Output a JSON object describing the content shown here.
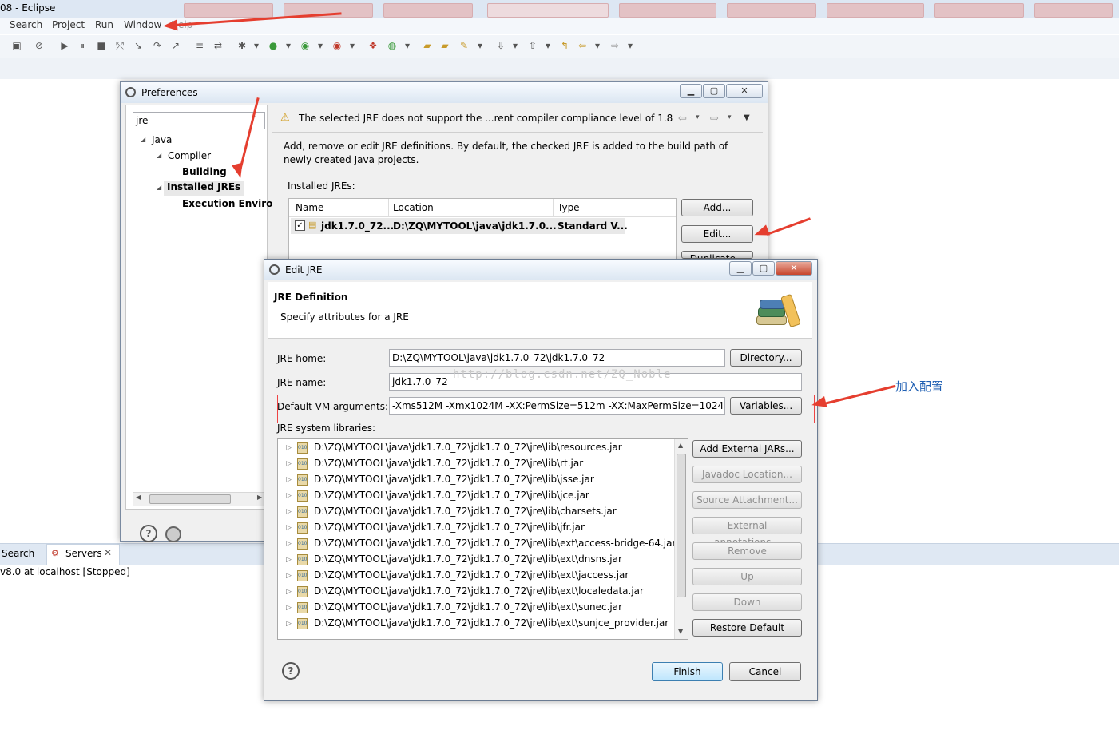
{
  "eclipse": {
    "title": "08 - Eclipse",
    "menu": [
      "Search",
      "Project",
      "Run",
      "Window",
      "Help"
    ]
  },
  "servers": {
    "tabs": [
      "Search",
      "Servers"
    ],
    "entry": "v8.0 at localhost  [Stopped]"
  },
  "preferences": {
    "title": "Preferences",
    "filter_value": "jre",
    "tree": {
      "java": "Java",
      "compiler": "Compiler",
      "building": "Building",
      "installed_jres": "Installed JREs",
      "execution_env": "Execution Enviro"
    },
    "warning": "The selected JRE does not support the ...rent compiler compliance level of 1.8",
    "description": "Add, remove or edit JRE definitions. By default, the checked JRE is added to the build path of newly created Java projects.",
    "installed_label": "Installed JREs:",
    "columns": [
      "Name",
      "Location",
      "Type"
    ],
    "row": {
      "name": "jdk1.7.0_72...",
      "location": "D:\\ZQ\\MYTOOL\\java\\jdk1.7.0...",
      "type": "Standard V..."
    },
    "buttons": {
      "add": "Add...",
      "edit": "Edit...",
      "duplicate": "Duplicate..."
    }
  },
  "edit_jre": {
    "title": "Edit JRE",
    "heading": "JRE Definition",
    "subheading": "Specify attributes for a JRE",
    "jre_home_label": "JRE home:",
    "jre_home_value": "D:\\ZQ\\MYTOOL\\java\\jdk1.7.0_72\\jdk1.7.0_72",
    "directory_button": "Directory...",
    "jre_name_label": "JRE name:",
    "jre_name_value": "jdk1.7.0_72",
    "watermark": "http://blog.csdn.net/ZQ_Noble",
    "vm_args_label": "Default VM arguments:",
    "vm_args_value": "-Xms512M -Xmx1024M -XX:PermSize=512m -XX:MaxPermSize=1024m",
    "variables_button": "Variables...",
    "libraries_label": "JRE system libraries:",
    "libraries": [
      "D:\\ZQ\\MYTOOL\\java\\jdk1.7.0_72\\jdk1.7.0_72\\jre\\lib\\resources.jar",
      "D:\\ZQ\\MYTOOL\\java\\jdk1.7.0_72\\jdk1.7.0_72\\jre\\lib\\rt.jar",
      "D:\\ZQ\\MYTOOL\\java\\jdk1.7.0_72\\jdk1.7.0_72\\jre\\lib\\jsse.jar",
      "D:\\ZQ\\MYTOOL\\java\\jdk1.7.0_72\\jdk1.7.0_72\\jre\\lib\\jce.jar",
      "D:\\ZQ\\MYTOOL\\java\\jdk1.7.0_72\\jdk1.7.0_72\\jre\\lib\\charsets.jar",
      "D:\\ZQ\\MYTOOL\\java\\jdk1.7.0_72\\jdk1.7.0_72\\jre\\lib\\jfr.jar",
      "D:\\ZQ\\MYTOOL\\java\\jdk1.7.0_72\\jdk1.7.0_72\\jre\\lib\\ext\\access-bridge-64.jar",
      "D:\\ZQ\\MYTOOL\\java\\jdk1.7.0_72\\jdk1.7.0_72\\jre\\lib\\ext\\dnsns.jar",
      "D:\\ZQ\\MYTOOL\\java\\jdk1.7.0_72\\jdk1.7.0_72\\jre\\lib\\ext\\jaccess.jar",
      "D:\\ZQ\\MYTOOL\\java\\jdk1.7.0_72\\jdk1.7.0_72\\jre\\lib\\ext\\localedata.jar",
      "D:\\ZQ\\MYTOOL\\java\\jdk1.7.0_72\\jdk1.7.0_72\\jre\\lib\\ext\\sunec.jar",
      "D:\\ZQ\\MYTOOL\\java\\jdk1.7.0_72\\jdk1.7.0_72\\jre\\lib\\ext\\sunjce_provider.jar"
    ],
    "side_buttons": {
      "add_external": "Add External JARs...",
      "javadoc": "Javadoc Location...",
      "source": "Source Attachment...",
      "annotations": "External annotations...",
      "remove": "Remove",
      "up": "Up",
      "down": "Down",
      "restore": "Restore Default"
    },
    "finish": "Finish",
    "cancel": "Cancel"
  },
  "annotation_text": "加入配置",
  "colors": {
    "accent_red": "#e53e2f",
    "annotation_blue": "#1f5fb3"
  }
}
